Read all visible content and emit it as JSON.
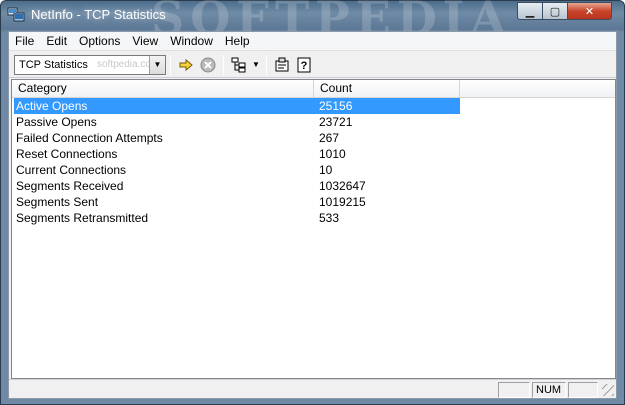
{
  "window": {
    "title": "NetInfo - TCP Statistics",
    "watermark": "SOFTPEDIA",
    "controls": {
      "minimize": "▁",
      "maximize": "▢",
      "close": "✕"
    }
  },
  "menu": [
    "File",
    "Edit",
    "Options",
    "View",
    "Window",
    "Help"
  ],
  "toolbar": {
    "combo_value": "TCP Statistics",
    "combo_ghost": "softpedia.com",
    "icons": [
      "go-arrow-icon",
      "stop-icon",
      "network-tree-icon",
      "properties-icon",
      "help-icon"
    ]
  },
  "table": {
    "columns": [
      "Category",
      "Count"
    ],
    "rows": [
      {
        "category": "Active Opens",
        "count": "25156",
        "selected": true
      },
      {
        "category": "Passive Opens",
        "count": "23721"
      },
      {
        "category": "Failed Connection Attempts",
        "count": "267"
      },
      {
        "category": "Reset Connections",
        "count": "1010"
      },
      {
        "category": "Current Connections",
        "count": "10"
      },
      {
        "category": "Segments Received",
        "count": "1032647"
      },
      {
        "category": "Segments Sent",
        "count": "1019215"
      },
      {
        "category": "Segments Retransmitted",
        "count": "533"
      }
    ]
  },
  "status": {
    "num": "NUM"
  },
  "colors": {
    "selection": "#3399ff",
    "accent_title": "#5d7896"
  }
}
